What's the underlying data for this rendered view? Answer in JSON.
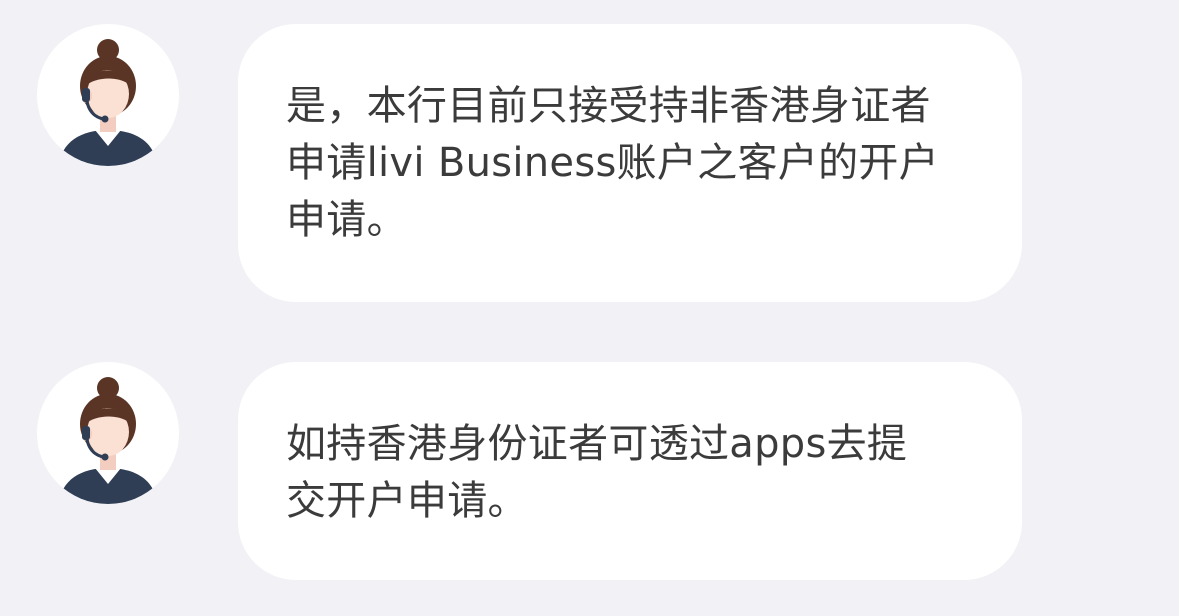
{
  "messages": [
    {
      "sender_icon": "customer-service-agent-icon",
      "text": "是，本行目前只接受持非香港身证者\n申请livi Business账户之客户的开户\n申请。"
    },
    {
      "sender_icon": "customer-service-agent-icon",
      "text": "如持香港身份证者可透过apps去提\n交开户申请。"
    }
  ],
  "colors": {
    "background": "#f2f2f6",
    "bubble": "#ffffff",
    "text": "#3b3b3b",
    "agent_hair": "#5a3526",
    "agent_skin": "#fbe0d4",
    "agent_uniform": "#2f3e55"
  }
}
